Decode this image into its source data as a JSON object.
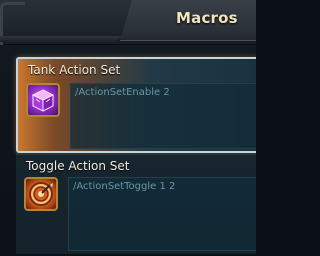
{
  "window": {
    "title": "Macros"
  },
  "macros": [
    {
      "name": "Tank Action Set",
      "command": "/ActionSetEnable 2",
      "icon": "purple-cube-icon",
      "selected": true
    },
    {
      "name": "Toggle Action Set",
      "command": "/ActionSetToggle 1 2",
      "icon": "target-icon",
      "selected": false
    }
  ],
  "colors": {
    "title_text": "#f1e3bf",
    "selected_highlight": "#c9772e",
    "macro_text": "#6a97a7",
    "icon_border": "#b5852f"
  }
}
